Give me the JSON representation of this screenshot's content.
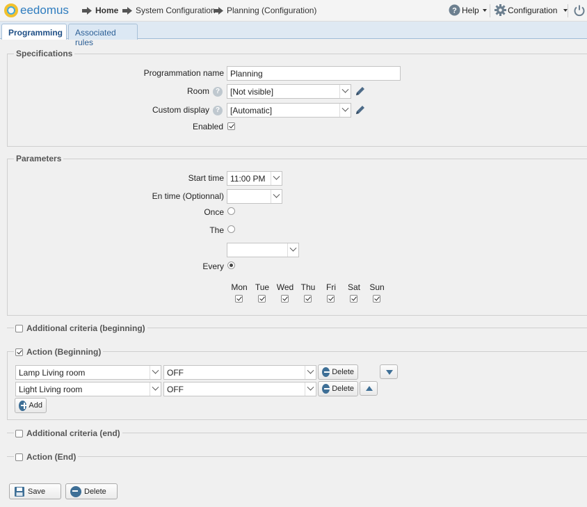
{
  "header": {
    "logo_text": "eedomus",
    "breadcrumb": [
      {
        "label": "Home"
      },
      {
        "label": "System Configuration"
      },
      {
        "label": "Planning (Configuration)"
      }
    ],
    "help_label": "Help",
    "config_label": "Configuration"
  },
  "tabs": [
    {
      "label": "Programming",
      "active": true
    },
    {
      "label": "Associated rules",
      "active": false
    }
  ],
  "specifications": {
    "legend": "Specifications",
    "name_label": "Programmation name",
    "name_value": "Planning",
    "room_label": "Room",
    "room_value": "[Not visible]",
    "display_label": "Custom display",
    "display_value": "[Automatic]",
    "enabled_label": "Enabled",
    "enabled": true
  },
  "parameters": {
    "legend": "Parameters",
    "start_label": "Start time",
    "start_value": "11:00 PM",
    "end_label": "En time (Optionnal)",
    "end_value": "",
    "once_label": "Once",
    "the_label": "The",
    "the_value": "",
    "every_label": "Every",
    "mode": "every",
    "days": [
      {
        "label": "Mon",
        "checked": true
      },
      {
        "label": "Tue",
        "checked": true
      },
      {
        "label": "Wed",
        "checked": true
      },
      {
        "label": "Thu",
        "checked": true
      },
      {
        "label": "Fri",
        "checked": true
      },
      {
        "label": "Sat",
        "checked": true
      },
      {
        "label": "Sun",
        "checked": true
      }
    ]
  },
  "additional_begin": {
    "label": "Additional criteria (beginning)",
    "checked": false
  },
  "action_begin": {
    "label": "Action (Beginning)",
    "checked": true,
    "rows": [
      {
        "device": "Lamp Living room",
        "value": "OFF",
        "delete_label": "Delete"
      },
      {
        "device": "Light Living room",
        "value": "OFF",
        "delete_label": "Delete"
      }
    ],
    "add_label": "Add"
  },
  "additional_end": {
    "label": "Additional criteria (end)",
    "checked": false
  },
  "action_end": {
    "label": "Action (End)",
    "checked": false
  },
  "footer": {
    "save_label": "Save",
    "delete_label": "Delete"
  }
}
